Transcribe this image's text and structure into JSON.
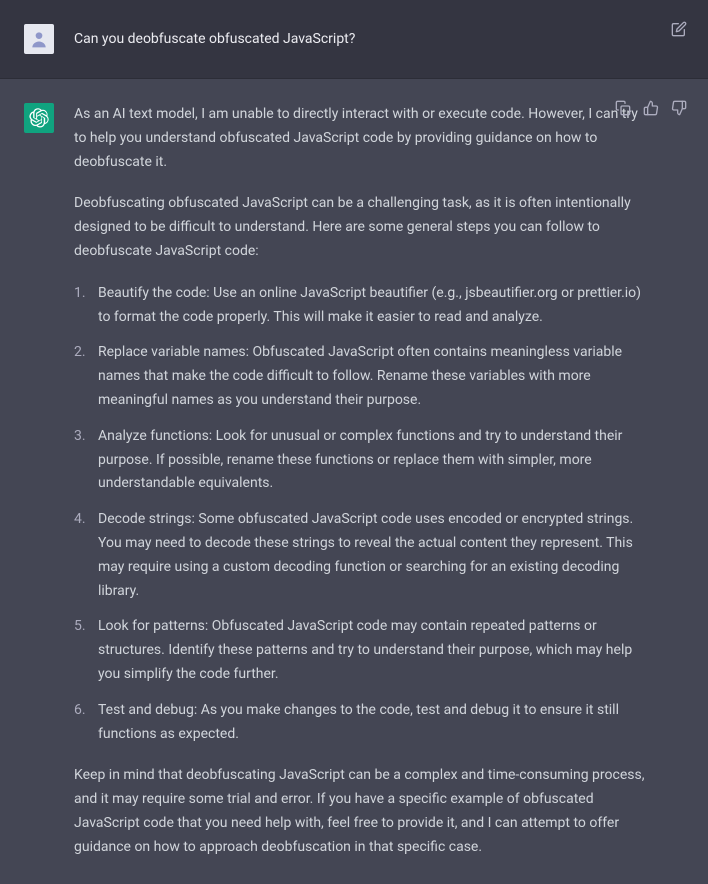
{
  "user": {
    "message": "Can you deobfuscate obfuscated JavaScript?"
  },
  "assistant": {
    "intro": "As an AI text model, I am unable to directly interact with or execute code. However, I can try to help you understand obfuscated JavaScript code by providing guidance on how to deobfuscate it.",
    "para2": "Deobfuscating obfuscated JavaScript can be a challenging task, as it is often intentionally designed to be difficult to understand. Here are some general steps you can follow to deobfuscate JavaScript code:",
    "steps": [
      "Beautify the code: Use an online JavaScript beautifier (e.g., jsbeautifier.org or prettier.io) to format the code properly. This will make it easier to read and analyze.",
      "Replace variable names: Obfuscated JavaScript often contains meaningless variable names that make the code difficult to follow. Rename these variables with more meaningful names as you understand their purpose.",
      "Analyze functions: Look for unusual or complex functions and try to understand their purpose. If possible, rename these functions or replace them with simpler, more understandable equivalents.",
      "Decode strings: Some obfuscated JavaScript code uses encoded or encrypted strings. You may need to decode these strings to reveal the actual content they represent. This may require using a custom decoding function or searching for an existing decoding library.",
      "Look for patterns: Obfuscated JavaScript code may contain repeated patterns or structures. Identify these patterns and try to understand their purpose, which may help you simplify the code further.",
      "Test and debug: As you make changes to the code, test and debug it to ensure it still functions as expected."
    ],
    "outro": "Keep in mind that deobfuscating JavaScript can be a complex and time-consuming process, and it may require some trial and error. If you have a specific example of obfuscated JavaScript code that you need help with, feel free to provide it, and I can attempt to offer guidance on how to approach deobfuscation in that specific case."
  }
}
